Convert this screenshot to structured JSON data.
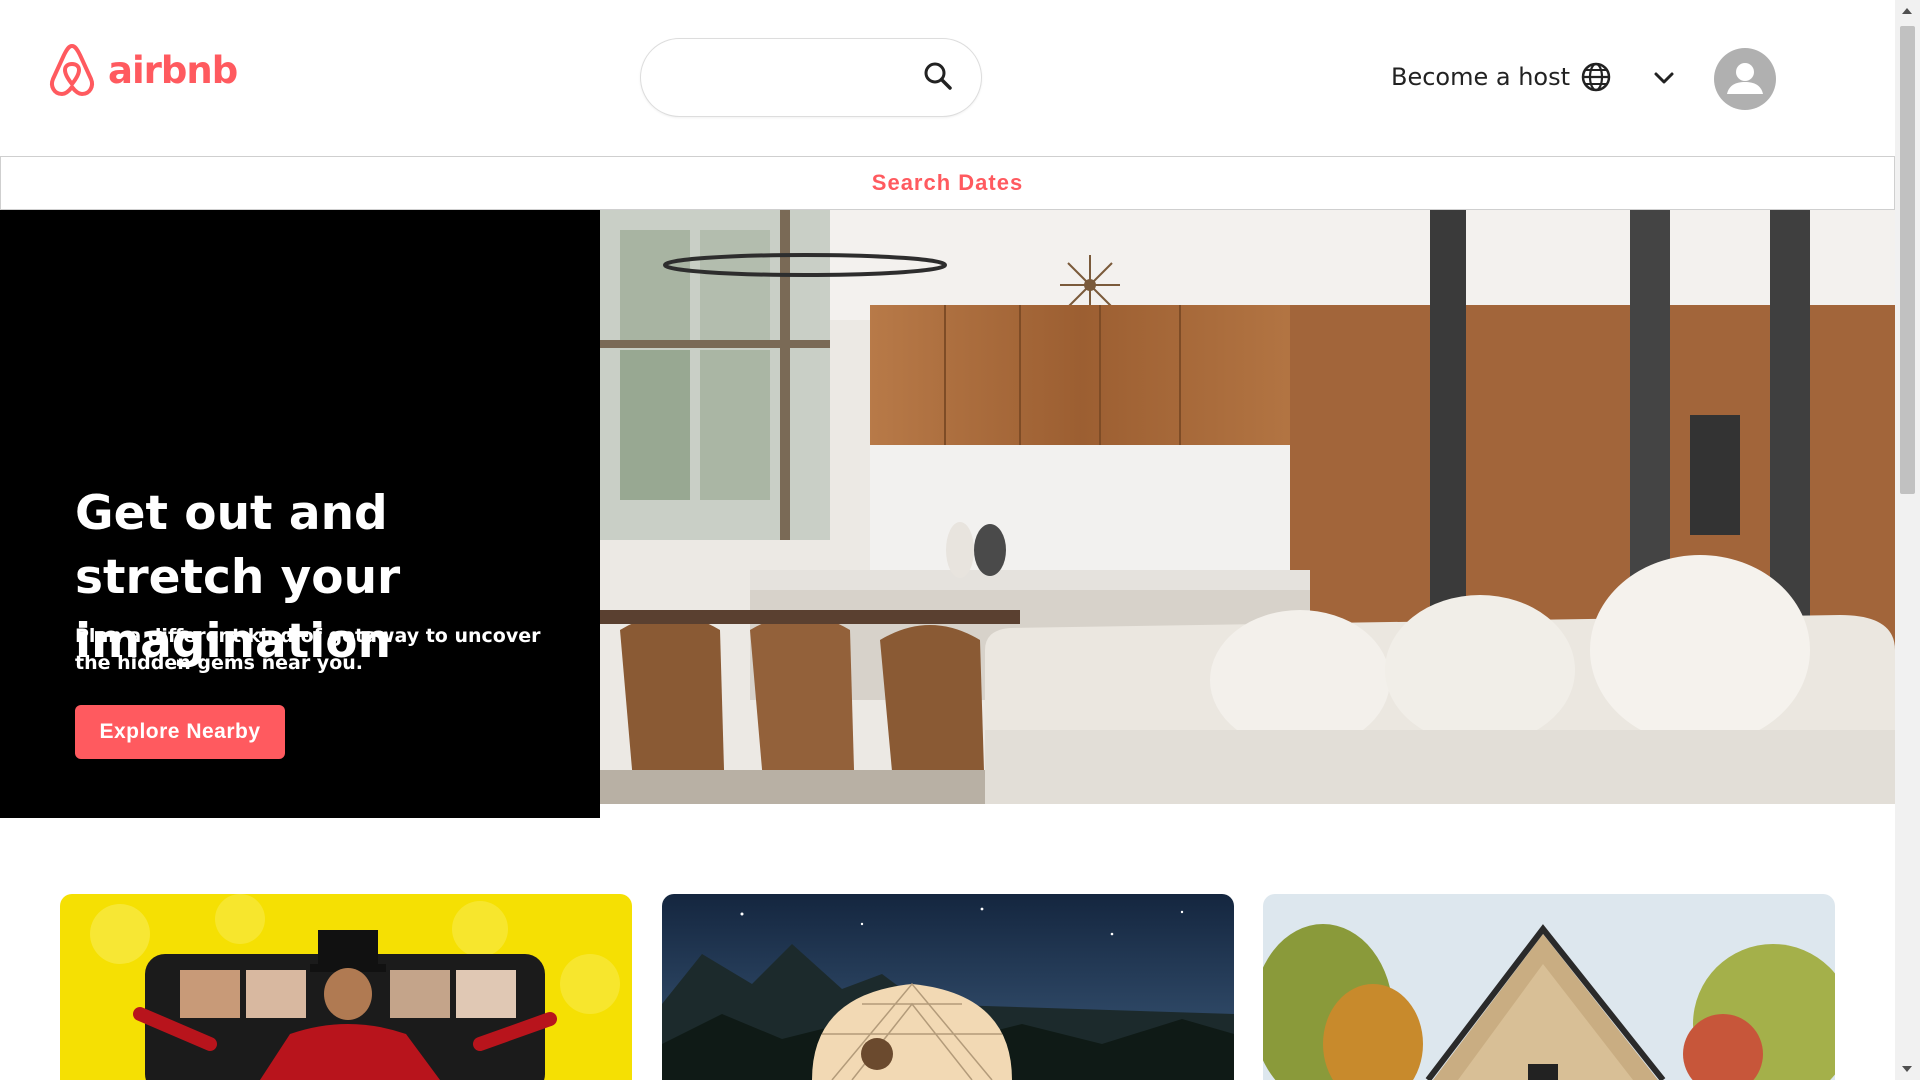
{
  "brand": {
    "name": "airbnb",
    "color": "#ff5a5f",
    "logo_icon": "airbnb-belo-icon"
  },
  "header": {
    "search": {
      "value": "",
      "placeholder": "",
      "icon": "search-icon"
    },
    "host_link": "Become a host",
    "language_icon": "globe-icon",
    "menu_icon": "chevron-down-icon",
    "profile_icon": "avatar-icon"
  },
  "dates_bar": {
    "label": "Search Dates"
  },
  "hero": {
    "title": "Get out and stretch your imagination",
    "subtitle": "Plan a different kind of getaway to uncover the hidden gems near you.",
    "button_label": "Explore Nearby",
    "background": "#000000",
    "image": "modern-kitchen-living-room-photo"
  },
  "cards": [
    {
      "image": "online-experience-host-photo"
    },
    {
      "image": "geodesic-dome-night-photo"
    },
    {
      "image": "a-frame-cabin-photo"
    }
  ],
  "colors": {
    "accent": "#ff5a5f",
    "text": "#222222"
  }
}
